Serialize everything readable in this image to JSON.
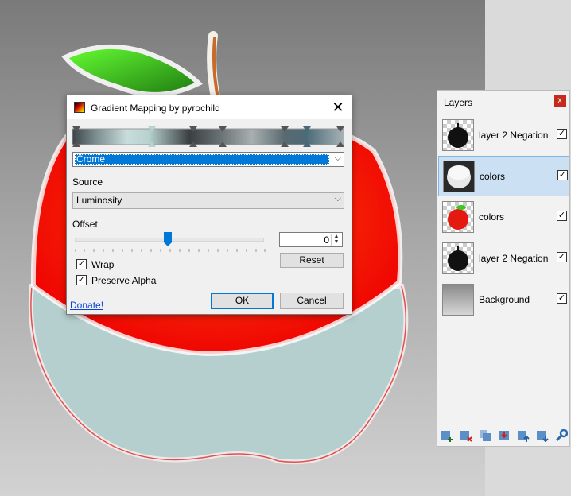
{
  "dialog": {
    "title": "Gradient Mapping by pyrochild",
    "close_glyph": "✕",
    "preset": "Crome",
    "source_label": "Source",
    "source_value": "Luminosity",
    "offset_label": "Offset",
    "offset_value": "0",
    "reset_label": "Reset",
    "wrap_label": "Wrap",
    "wrap_checked": true,
    "alpha_label": "Preserve Alpha",
    "alpha_checked": true,
    "donate_label": "Donate!",
    "ok_label": "OK",
    "cancel_label": "Cancel",
    "check_glyph": "✓",
    "chevron_glyph": "⌵",
    "slider_level": 0.5
  },
  "layers_panel": {
    "title": "Layers",
    "close_glyph": "x",
    "check_glyph": "✓",
    "items": [
      {
        "name": "layer 2 Negation",
        "visible": true,
        "thumb": "black-apple"
      },
      {
        "name": "colors",
        "visible": true,
        "thumb": "white-apple",
        "selected": true
      },
      {
        "name": "colors",
        "visible": true,
        "thumb": "red-apple"
      },
      {
        "name": "layer 2 Negation",
        "visible": true,
        "thumb": "black-apple"
      },
      {
        "name": "Background",
        "visible": true,
        "thumb": "gray-gradient"
      }
    ],
    "toolbar_icons": [
      "add-layer-icon",
      "delete-layer-icon",
      "duplicate-layer-icon",
      "merge-down-icon",
      "move-up-icon",
      "move-down-icon",
      "properties-wrench-icon"
    ]
  },
  "colors": {
    "accent": "#0078d7",
    "apple_red": "#ff1a00",
    "apple_blue_gray": "#b5cfcf",
    "leaf_green": "#3ec61e"
  }
}
